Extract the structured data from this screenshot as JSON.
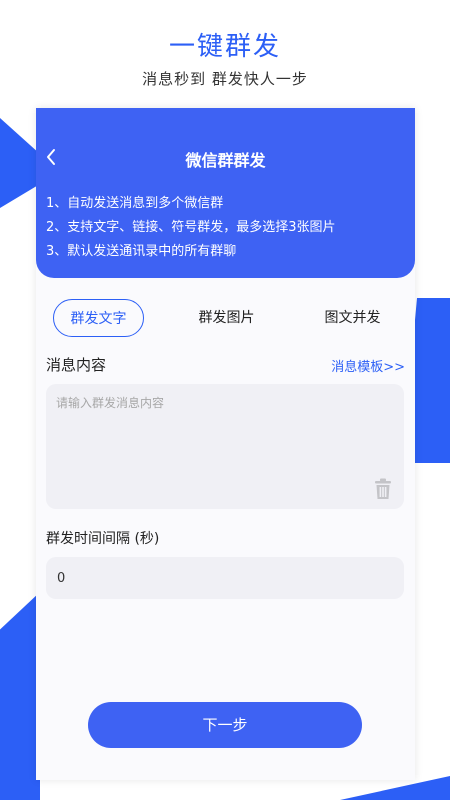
{
  "header": {
    "headline": "一键群发",
    "subline": "消息秒到 群发快人一步"
  },
  "panel": {
    "title": "微信群群发",
    "tips": [
      "1、自动发送消息到多个微信群",
      "2、支持文字、链接、符号群发，最多选择3张图片",
      "3、默认发送通讯录中的所有群聊"
    ]
  },
  "tabs": [
    {
      "label": "群发文字",
      "active": true
    },
    {
      "label": "群发图片",
      "active": false
    },
    {
      "label": "图文并发",
      "active": false
    }
  ],
  "message": {
    "label": "消息内容",
    "template_link": "消息模板>>",
    "placeholder": "请输入群发消息内容",
    "value": ""
  },
  "interval": {
    "label": "群发时间间隔 (秒)",
    "value": "0"
  },
  "next_button": "下一步",
  "colors": {
    "accent": "#3e62f3",
    "brand_blue": "#2c5ff6",
    "input_bg": "#f0f0f5"
  },
  "icons": {
    "back": "chevron-left-icon",
    "delete": "trash-icon"
  }
}
